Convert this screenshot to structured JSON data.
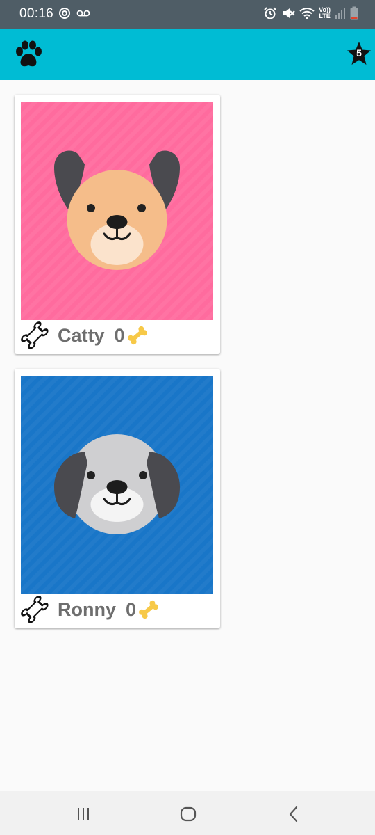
{
  "status_bar": {
    "time": "00:16",
    "left_icons": [
      "sync-icon",
      "voicemail-icon"
    ],
    "right_icons": [
      "alarm-icon",
      "mute-icon",
      "wifi-icon",
      "volte-lte-icon",
      "signal-icon",
      "battery-icon"
    ],
    "volte_top": "Vo))",
    "volte_bottom": "LTE"
  },
  "app_bar": {
    "logo_icon": "paw-icon",
    "star_count": "5",
    "color": "#00bcd4"
  },
  "pets": [
    {
      "name": "Catty",
      "bones": "0",
      "background": "#ff6b9e"
    },
    {
      "name": "Ronny",
      "bones": "0",
      "background": "#1976c8"
    }
  ],
  "nav_bar": {
    "buttons": [
      "recent-apps-icon",
      "home-icon",
      "back-icon"
    ]
  }
}
